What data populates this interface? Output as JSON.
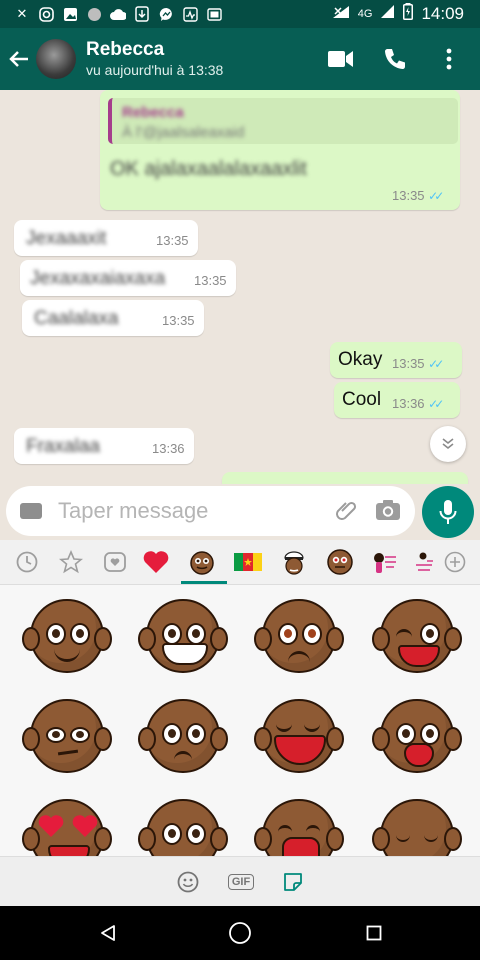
{
  "status_bar": {
    "network": "4G",
    "time": "14:09",
    "left_icons": [
      "cross-icon",
      "instagram-icon",
      "image-icon",
      "circle-icon",
      "cloud-icon",
      "download-icon",
      "messenger-icon",
      "activity-icon",
      "screen-icon"
    ]
  },
  "header": {
    "contact_name": "Rebecca",
    "last_seen": "vu aujourd'hui à 13:38",
    "actions": [
      "video-call-icon",
      "phone-icon",
      "more-options-icon"
    ]
  },
  "messages": [
    {
      "direction": "out",
      "quoted_author": "Rebecca",
      "quoted_text": "À l'@jaalsaleaxaid",
      "text": "OK ajalaxaalalaxaaxlit",
      "time": "13:35",
      "status": "read"
    },
    {
      "direction": "in",
      "text": "Jexaaaxit",
      "time": "13:35"
    },
    {
      "direction": "in",
      "text": "Jexaxaxaiaxaxa",
      "time": "13:35"
    },
    {
      "direction": "in",
      "text": "Caalalaxa",
      "time": "13:35"
    },
    {
      "direction": "out",
      "text": "Okay",
      "time": "13:35",
      "status": "read"
    },
    {
      "direction": "out",
      "text": "Cool",
      "time": "13:36",
      "status": "read"
    },
    {
      "direction": "in",
      "text": "Fraxalaa",
      "time": "13:36"
    }
  ],
  "composer": {
    "placeholder": "Taper message"
  },
  "sticker_panel": {
    "tabs": [
      "recent-icon",
      "favorites-icon",
      "saved-icon",
      "heart-sticker-tab",
      "face-sticker-tab",
      "cameroon-sticker-tab",
      "sailor-sticker-tab",
      "afro-sticker-tab",
      "pink-sticker-tab-1",
      "pink-sticker-tab-2",
      "add-sticker-pack-icon"
    ],
    "selected_tab": "face-sticker-tab"
  },
  "bottom_bar": {
    "gif_label": "GIF",
    "selected": "sticker-icon"
  }
}
